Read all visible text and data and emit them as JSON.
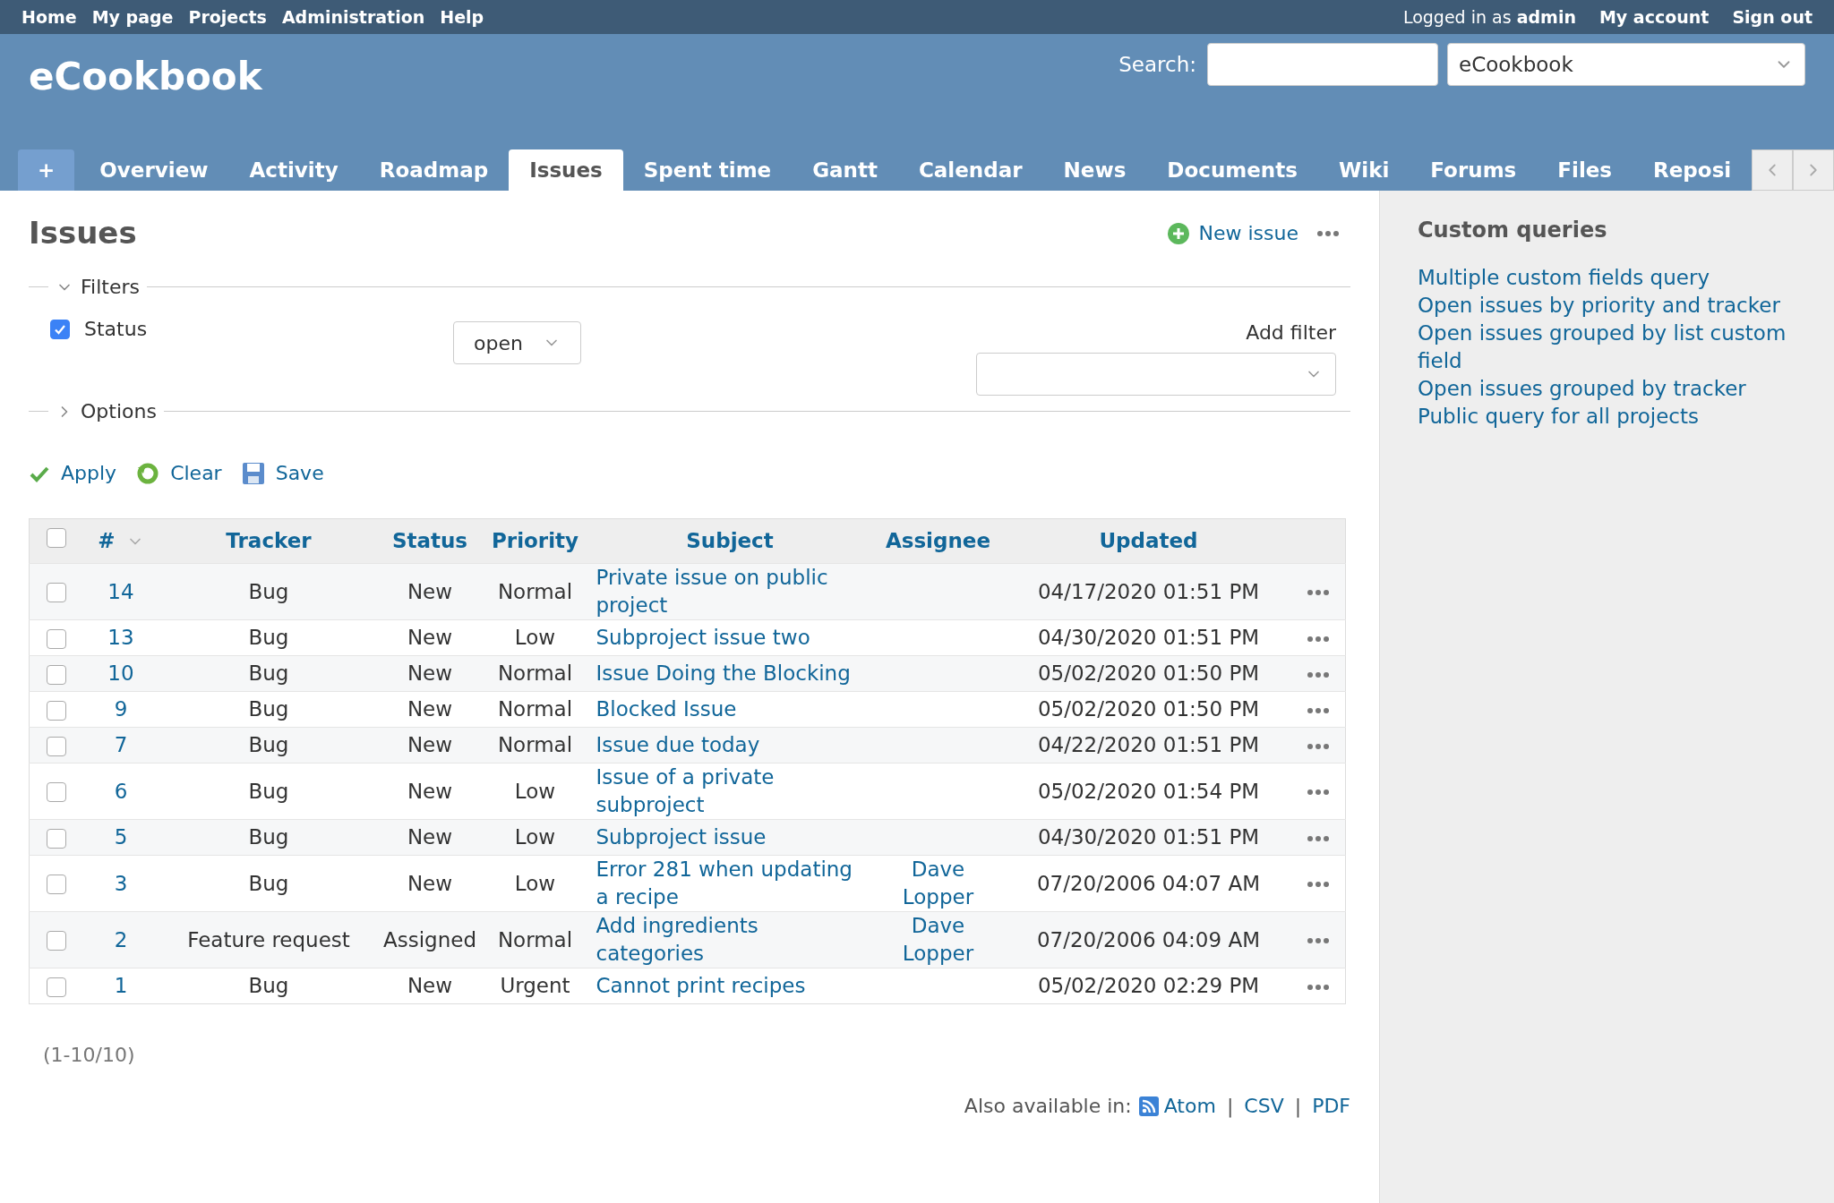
{
  "top_menu": {
    "left": [
      "Home",
      "My page",
      "Projects",
      "Administration",
      "Help"
    ],
    "logged_in_label": "Logged in as",
    "user": "admin",
    "right": [
      "My account",
      "Sign out"
    ]
  },
  "header": {
    "title": "eCookbook",
    "search_label": "Search:",
    "project_select": "eCookbook"
  },
  "tabs": [
    {
      "label": "+",
      "kind": "new",
      "selected": false
    },
    {
      "label": "Overview",
      "kind": "tab",
      "selected": false
    },
    {
      "label": "Activity",
      "kind": "tab",
      "selected": false
    },
    {
      "label": "Roadmap",
      "kind": "tab",
      "selected": false
    },
    {
      "label": "Issues",
      "kind": "tab",
      "selected": true
    },
    {
      "label": "Spent time",
      "kind": "tab",
      "selected": false
    },
    {
      "label": "Gantt",
      "kind": "tab",
      "selected": false
    },
    {
      "label": "Calendar",
      "kind": "tab",
      "selected": false
    },
    {
      "label": "News",
      "kind": "tab",
      "selected": false
    },
    {
      "label": "Documents",
      "kind": "tab",
      "selected": false
    },
    {
      "label": "Wiki",
      "kind": "tab",
      "selected": false
    },
    {
      "label": "Forums",
      "kind": "tab",
      "selected": false
    },
    {
      "label": "Files",
      "kind": "tab",
      "selected": false
    },
    {
      "label": "Reposi",
      "kind": "tab",
      "selected": false
    }
  ],
  "page": {
    "title": "Issues",
    "new_issue": "New issue"
  },
  "filters": {
    "legend": "Filters",
    "expanded": true,
    "status": {
      "label": "Status",
      "checked": true,
      "operator": "open"
    },
    "add_filter_label": "Add filter"
  },
  "options": {
    "legend": "Options",
    "expanded": false
  },
  "actions": [
    "Apply",
    "Clear",
    "Save"
  ],
  "table": {
    "columns": [
      "#",
      "Tracker",
      "Status",
      "Priority",
      "Subject",
      "Assignee",
      "Updated"
    ],
    "header_checked": false,
    "rows": [
      {
        "id": "14",
        "tracker": "Bug",
        "status": "New",
        "priority": "Normal",
        "subject": "Private issue on public project",
        "assignee": "",
        "updated": "04/17/2020 01:51 PM",
        "checked": false
      },
      {
        "id": "13",
        "tracker": "Bug",
        "status": "New",
        "priority": "Low",
        "subject": "Subproject issue two",
        "assignee": "",
        "updated": "04/30/2020 01:51 PM",
        "checked": false
      },
      {
        "id": "10",
        "tracker": "Bug",
        "status": "New",
        "priority": "Normal",
        "subject": "Issue Doing the Blocking",
        "assignee": "",
        "updated": "05/02/2020 01:50 PM",
        "checked": false
      },
      {
        "id": "9",
        "tracker": "Bug",
        "status": "New",
        "priority": "Normal",
        "subject": "Blocked Issue",
        "assignee": "",
        "updated": "05/02/2020 01:50 PM",
        "checked": false
      },
      {
        "id": "7",
        "tracker": "Bug",
        "status": "New",
        "priority": "Normal",
        "subject": "Issue due today",
        "assignee": "",
        "updated": "04/22/2020 01:51 PM",
        "checked": false
      },
      {
        "id": "6",
        "tracker": "Bug",
        "status": "New",
        "priority": "Low",
        "subject": "Issue of a private subproject",
        "assignee": "",
        "updated": "05/02/2020 01:54 PM",
        "checked": false
      },
      {
        "id": "5",
        "tracker": "Bug",
        "status": "New",
        "priority": "Low",
        "subject": "Subproject issue",
        "assignee": "",
        "updated": "04/30/2020 01:51 PM",
        "checked": false
      },
      {
        "id": "3",
        "tracker": "Bug",
        "status": "New",
        "priority": "Low",
        "subject": "Error 281 when updating a recipe",
        "assignee": "Dave Lopper",
        "updated": "07/20/2006 04:07 AM",
        "checked": false
      },
      {
        "id": "2",
        "tracker": "Feature request",
        "status": "Assigned",
        "priority": "Normal",
        "subject": "Add ingredients categories",
        "assignee": "Dave Lopper",
        "updated": "07/20/2006 04:09 AM",
        "checked": false
      },
      {
        "id": "1",
        "tracker": "Bug",
        "status": "New",
        "priority": "Urgent",
        "subject": "Cannot print recipes",
        "assignee": "",
        "updated": "05/02/2020 02:29 PM",
        "checked": false
      }
    ]
  },
  "pagination": "(1-10/10)",
  "export": {
    "label": "Also available in:",
    "formats": [
      "Atom",
      "CSV",
      "PDF"
    ],
    "separators": [
      "|",
      "|"
    ]
  },
  "sidebar": {
    "title": "Custom queries",
    "queries": [
      "Multiple custom fields query",
      "Open issues by priority and tracker",
      "Open issues grouped by list custom field",
      "Open issues grouped by tracker",
      "Public query for all projects"
    ]
  }
}
